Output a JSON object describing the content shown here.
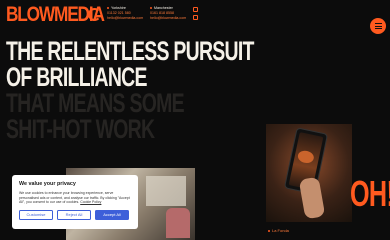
{
  "brand": {
    "logo_text": "BLOWMEDIA",
    "accent": "#ff5a1f"
  },
  "contacts": [
    {
      "heading": "Yorkshire",
      "phone": "01132 021 580",
      "email": "hello@blowmedia.com"
    },
    {
      "heading": "Manchester",
      "phone": "0161 818 8558",
      "email": "hello@blowmedia.com"
    }
  ],
  "social_icons": [
    "instagram-icon",
    "linkedin-icon"
  ],
  "menu": {
    "icon": "hamburger-icon"
  },
  "hero": {
    "line1": "THE RELENTLESS PURSUIT",
    "line2": "OF BRILLIANCE",
    "line3": "THAT MEANS SOME",
    "line4": "SHIT-HOT WORK"
  },
  "case_study": {
    "label": "La Fonda",
    "oh_text": "OH!"
  },
  "cookie_banner": {
    "title": "We value your privacy",
    "body": "We use cookies to enhance your browsing experience, serve personalised ads or content, and analyse our traffic. By clicking \"Accept All\", you consent to our use of cookies.",
    "policy_link": "Cookie Policy",
    "customise_label": "Customise",
    "reject_label": "Reject All",
    "accept_label": "Accept All"
  }
}
